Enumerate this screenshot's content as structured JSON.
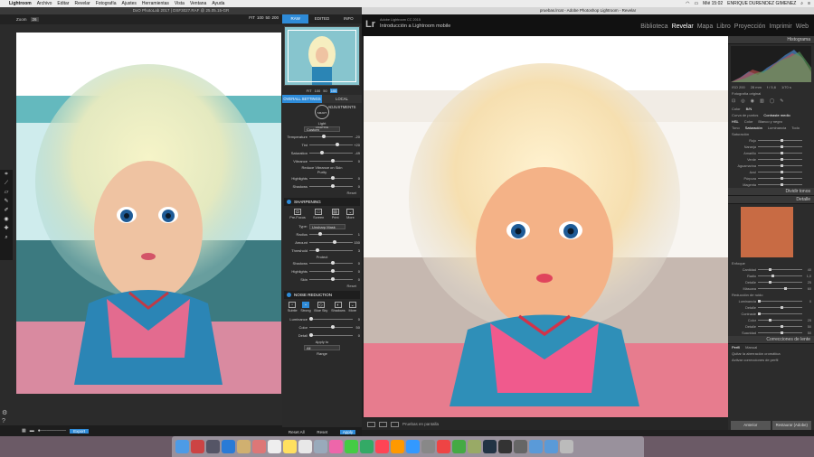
{
  "menubar": {
    "app": "Lightroom",
    "items": [
      "Archivo",
      "Editar",
      "Revelar",
      "Fotografía",
      "Ajustes",
      "Herramientas",
      "Vista",
      "Ventana",
      "Ayuda"
    ],
    "day_time": "Mié 15:02",
    "user": "ENRIQUE DURENDEZ GIMENEZ"
  },
  "dxo": {
    "title": "DxO PhotoLab 2017 | DSF3027.RAF @ 25.05.15-GR",
    "zoom_label": "Zoom",
    "zoom_value": "26",
    "zoom_buttons": [
      "FIT",
      "100",
      "50",
      "200"
    ],
    "bottom_button": "Export",
    "panel": {
      "tabs": [
        "RAW",
        "EDITED",
        "INFO"
      ],
      "zoom_sizes": [
        "FIT",
        "100",
        "50",
        "100"
      ],
      "settings_tabs": [
        "OVERALL SETTINGS",
        "LOCAL ADJUSTMENTS"
      ],
      "smart_lighting": "SMART LIGHTING",
      "light_label": "Light",
      "custom": "Custom",
      "sliders_top": [
        {
          "label": "Temperature",
          "value": "-20"
        },
        {
          "label": "Tint",
          "value": "+20"
        },
        {
          "label": "Saturation",
          "value": "-49"
        },
        {
          "label": "Vibrance",
          "value": "0"
        }
      ],
      "protect_skin": "Reduce Vibrance on Skin",
      "purity": "Purity",
      "highlights_label": "Highlights",
      "highlights_value": "0",
      "shadows_label": "Shadows",
      "shadows_value": "0",
      "reset": "Reset",
      "sharpening": {
        "title": "SHARPENING",
        "icons": [
          "Pre-Focus",
          "Screen",
          "Print",
          "More"
        ],
        "type_label": "Type:",
        "type_value": "Unsharp Mask",
        "sliders": [
          {
            "label": "Radius",
            "value": "1"
          },
          {
            "label": "Amount",
            "value": "150"
          },
          {
            "label": "Threshold",
            "value": "3"
          }
        ],
        "protect": "Protect",
        "protect_sliders": [
          {
            "label": "Shadows",
            "value": "0"
          },
          {
            "label": "Highlights",
            "value": "0"
          },
          {
            "label": "Skin",
            "value": "0"
          }
        ]
      },
      "noise": {
        "title": "NOISE REDUCTION",
        "icons": [
          "Subtle",
          "Strong",
          "Blue Sky",
          "Shadows",
          "More"
        ],
        "sliders": [
          {
            "label": "Luminance",
            "value": "0"
          },
          {
            "label": "Color",
            "value": "50"
          },
          {
            "label": "Detail",
            "value": "0"
          }
        ],
        "apply_to": "Apply to",
        "all": "All",
        "range": "Range"
      },
      "bottom": [
        "Reset All",
        "Reset",
        "Apply"
      ]
    }
  },
  "lr": {
    "window_title": "pruebas.lrcat - Adobe Photoshop Lightroom - Revelar",
    "sub1": "Adobe Lightroom CC 2015",
    "sub2": "Introducción a Lightroom mobile",
    "modules": [
      "Biblioteca",
      "Revelar",
      "Mapa",
      "Libro",
      "Proyección",
      "Imprimir",
      "Web"
    ],
    "active_module": "Revelar",
    "histogram": "Histograma",
    "foto_original": "Fotografía original",
    "hist_values": [
      "ISO 200",
      "28 mm",
      "f / 5,6",
      "1/70 s"
    ],
    "color_tabs": [
      "Color",
      "B/N"
    ],
    "curve_label": "Curva de puntos",
    "curve_value": "Contraste medio",
    "hsl_tabs": [
      "HSL",
      "Color",
      "Blanco y negro"
    ],
    "hsl_sub": [
      "Tono",
      "Saturación",
      "Luminancia",
      "Todo"
    ],
    "saturation_label": "Saturación",
    "hsl_rows": [
      "Rojo",
      "Naranja",
      "Amarillo",
      "Verde",
      "Aguamarina",
      "Azul",
      "Púrpura",
      "Magenta"
    ],
    "divide_tonos": "Dividir tonos",
    "detalle": "Detalle",
    "enfoque": "Enfoque",
    "enfoque_rows": [
      {
        "label": "Cantidad",
        "value": "40"
      },
      {
        "label": "Radio",
        "value": "1,0"
      },
      {
        "label": "Detalle",
        "value": "25"
      },
      {
        "label": "Máscara",
        "value": "60"
      }
    ],
    "reduccion": "Reducción de ruido",
    "reduccion_rows": [
      {
        "label": "Luminancia",
        "value": "0"
      },
      {
        "label": "Detalle",
        "value": ""
      },
      {
        "label": "Contraste",
        "value": ""
      },
      {
        "label": "Color",
        "value": "25"
      },
      {
        "label": "Detalle",
        "value": "50"
      },
      {
        "label": "Suavidad",
        "value": "50"
      }
    ],
    "correcciones": "Correcciones de lente",
    "lens_tabs": [
      "Perfil",
      "Manual"
    ],
    "lens_checks": [
      "Quitar la aberración cromática",
      "Activar correcciones de perfil"
    ],
    "bottom_label": "Pruebas en pantalla",
    "bottom_buttons": [
      "Anterior",
      "Restaurar (Adobe)"
    ]
  }
}
